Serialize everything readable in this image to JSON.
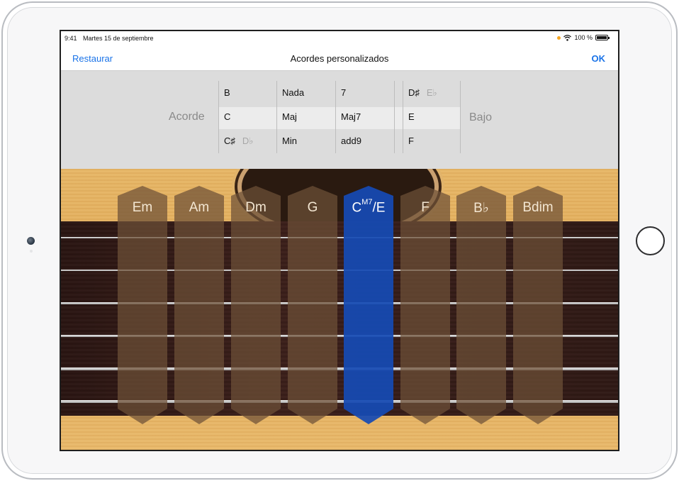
{
  "status": {
    "time": "9:41",
    "date": "Martes 15 de septiembre",
    "battery": "100 %"
  },
  "nav": {
    "left": "Restaurar",
    "title": "Acordes personalizados",
    "right": "OK"
  },
  "picker": {
    "label_left": "Acorde",
    "label_right": "Bajo",
    "root": [
      "B",
      "C",
      "C♯"
    ],
    "root_alt": "D♭",
    "quality": [
      "Nada",
      "Maj",
      "Min"
    ],
    "extension": [
      "7",
      "Maj7",
      "add9"
    ],
    "bass": [
      "D♯",
      "E",
      "F"
    ],
    "bass_alt": "E♭"
  },
  "chords": [
    {
      "label": "Em",
      "active": false
    },
    {
      "label": "Am",
      "active": false
    },
    {
      "label": "Dm",
      "active": false
    },
    {
      "label": "G",
      "active": false
    },
    {
      "label": "C",
      "sup": "M7",
      "suffix": "/E",
      "active": true
    },
    {
      "label": "F",
      "active": false
    },
    {
      "label": "B♭",
      "active": false
    },
    {
      "label": "Bdim",
      "active": false
    }
  ],
  "colors": {
    "link": "#1a73e8",
    "active_chord": "#164ab4",
    "wood": "#e0a956",
    "fretboard": "#3b1f1a"
  }
}
